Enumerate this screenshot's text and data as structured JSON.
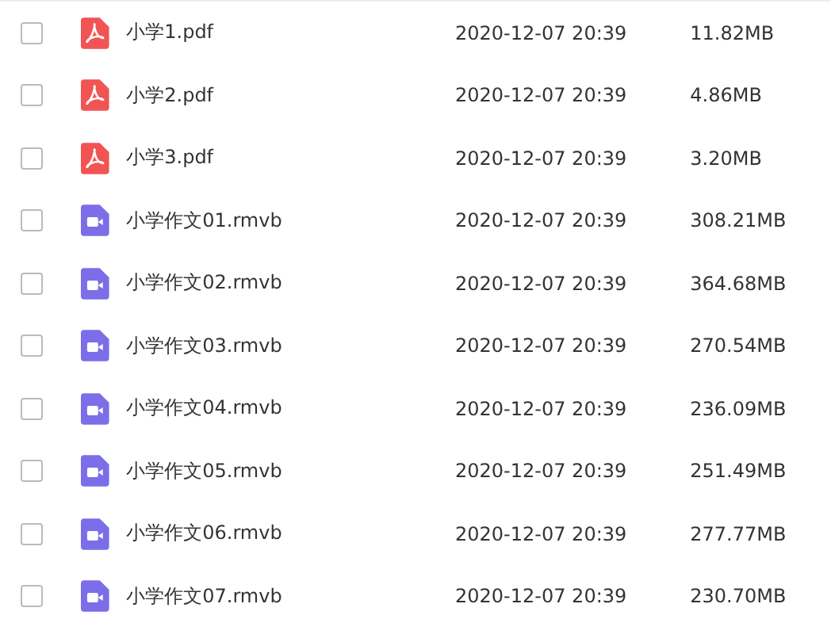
{
  "files": [
    {
      "kind": "pdf",
      "name": "小学1.pdf",
      "date": "2020-12-07 20:39",
      "size": "11.82MB",
      "checked": false
    },
    {
      "kind": "pdf",
      "name": "小学2.pdf",
      "date": "2020-12-07 20:39",
      "size": "4.86MB",
      "checked": false
    },
    {
      "kind": "pdf",
      "name": "小学3.pdf",
      "date": "2020-12-07 20:39",
      "size": "3.20MB",
      "checked": false
    },
    {
      "kind": "video",
      "name": "小学作文01.rmvb",
      "date": "2020-12-07 20:39",
      "size": "308.21MB",
      "checked": false
    },
    {
      "kind": "video",
      "name": "小学作文02.rmvb",
      "date": "2020-12-07 20:39",
      "size": "364.68MB",
      "checked": false
    },
    {
      "kind": "video",
      "name": "小学作文03.rmvb",
      "date": "2020-12-07 20:39",
      "size": "270.54MB",
      "checked": false
    },
    {
      "kind": "video",
      "name": "小学作文04.rmvb",
      "date": "2020-12-07 20:39",
      "size": "236.09MB",
      "checked": false
    },
    {
      "kind": "video",
      "name": "小学作文05.rmvb",
      "date": "2020-12-07 20:39",
      "size": "251.49MB",
      "checked": false
    },
    {
      "kind": "video",
      "name": "小学作文06.rmvb",
      "date": "2020-12-07 20:39",
      "size": "277.77MB",
      "checked": false
    },
    {
      "kind": "video",
      "name": "小学作文07.rmvb",
      "date": "2020-12-07 20:39",
      "size": "230.70MB",
      "checked": false
    }
  ]
}
